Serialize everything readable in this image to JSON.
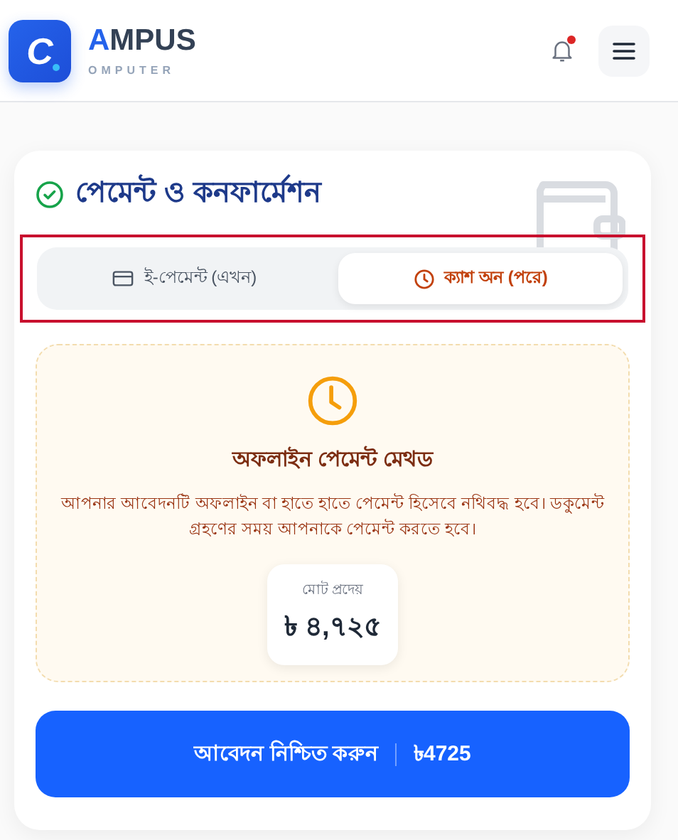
{
  "header": {
    "logo_letter": "C",
    "brand_title": "AMPUS",
    "brand_subtitle": "OMPUTER",
    "notification_unread": true
  },
  "card": {
    "title": "পেমেন্ট ও কনফার্মেশন",
    "highlighted": true,
    "tabs": [
      {
        "label": "ই-পেমেন্ট (এখন)",
        "kind": "card",
        "selected": false
      },
      {
        "label": "ক্যাশ অন (পরে)",
        "kind": "clock",
        "selected": true
      }
    ],
    "panel": {
      "title": "অফলাইন পেমেন্ট মেথড",
      "text": "আপনার আবেদনটি অফলাইন বা হাতে হাতে পেমেন্ট হিসেবে নথিবদ্ধ হবে। ডকুমেন্ট গ্রহণের সময় আপনাকে পেমেন্ট করতে হবে।",
      "total_label": "মোট প্রদেয়",
      "total_value": "৳ ৪,৭২৫"
    },
    "confirm_button": {
      "label": "আবেদন নিশ্চিত করুন",
      "amount": "৳4725"
    }
  }
}
